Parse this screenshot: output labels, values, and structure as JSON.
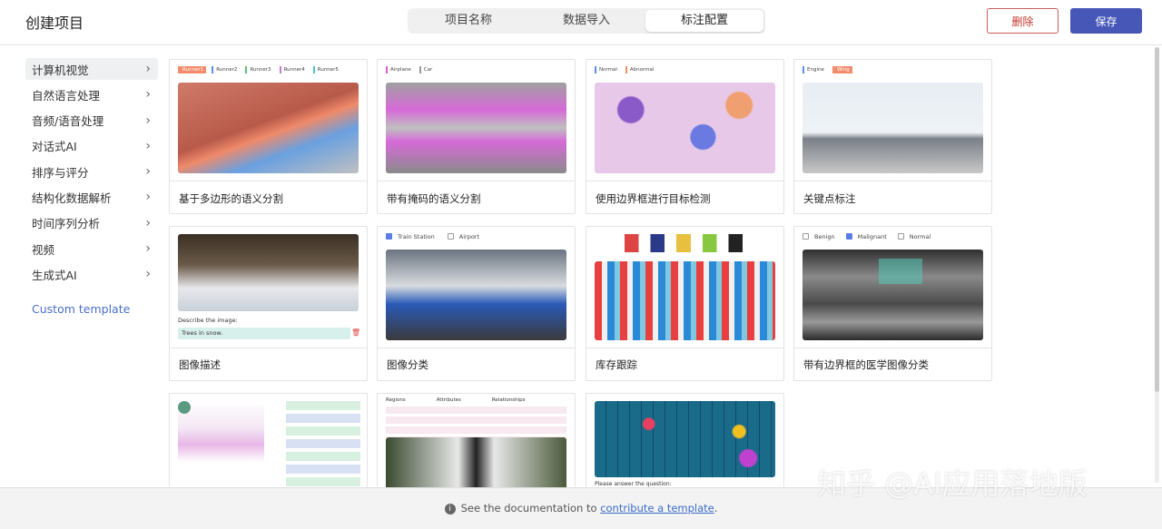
{
  "header": {
    "title": "创建项目",
    "tabs": [
      {
        "label": "项目名称"
      },
      {
        "label": "数据导入"
      },
      {
        "label": "标注配置"
      }
    ],
    "delete_label": "删除",
    "save_label": "保存"
  },
  "sidebar": {
    "items": [
      {
        "label": "计算机视觉"
      },
      {
        "label": "自然语言处理"
      },
      {
        "label": "音频/语音处理"
      },
      {
        "label": "对话式AI"
      },
      {
        "label": "排序与评分"
      },
      {
        "label": "结构化数据解析"
      },
      {
        "label": "时间序列分析"
      },
      {
        "label": "视频"
      },
      {
        "label": "生成式AI"
      }
    ],
    "custom_template": "Custom template"
  },
  "cards": [
    {
      "caption": "基于多边形的语义分割",
      "tags": [
        "Runner1",
        "Runner2",
        "Runner3",
        "Runner4",
        "Runner5"
      ]
    },
    {
      "caption": "带有掩码的语义分割",
      "tags": [
        "Airplane",
        "Car"
      ]
    },
    {
      "caption": "使用边界框进行目标检测",
      "tags": [
        "Normal",
        "Abnormal"
      ]
    },
    {
      "caption": "关键点标注",
      "tags": [
        "Engine",
        "Wing"
      ]
    },
    {
      "caption": "图像描述",
      "describe_label": "Describe the image:",
      "describe_value": "Trees in snow."
    },
    {
      "caption": "图像分类",
      "tags": [
        "Train Station",
        "Airport"
      ]
    },
    {
      "caption": "库存跟踪"
    },
    {
      "caption": "带有边界框的医学图像分类",
      "tags": [
        "Benign",
        "Malignant",
        "Normal"
      ]
    },
    {
      "caption": ""
    },
    {
      "caption": "",
      "cols": [
        "Regions",
        "Attributes",
        "Relationships"
      ]
    },
    {
      "caption": "",
      "question": "Please answer the question:"
    }
  ],
  "footer": {
    "text": "See the documentation to",
    "link": "contribute a template",
    "end": "."
  },
  "watermark": "知乎 @AI应用落地版",
  "colors": {
    "accent": "#4657b8",
    "danger": "#c0392b",
    "link": "#3b6cc9"
  }
}
